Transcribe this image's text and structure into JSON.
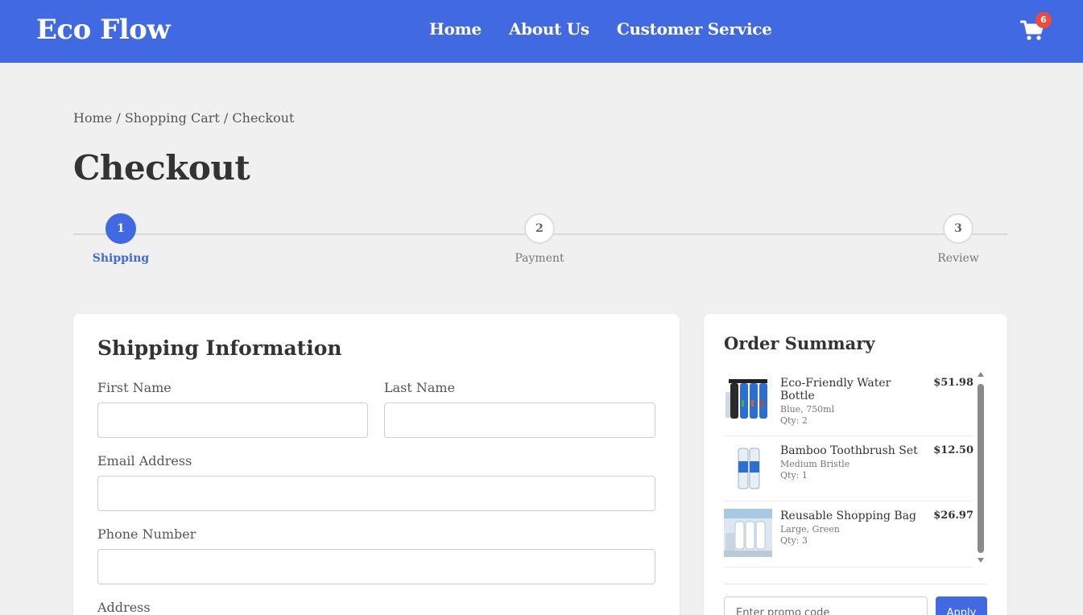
{
  "header": {
    "brand": "Eco Flow",
    "nav": [
      "Home",
      "About Us",
      "Customer Service"
    ],
    "cart_count": "6",
    "cart_icon": "shopping-cart-icon"
  },
  "breadcrumb": {
    "items": [
      "Home",
      "Shopping Cart",
      "Checkout"
    ],
    "separator": "/"
  },
  "page_title": "Checkout",
  "steps": [
    {
      "number": "1",
      "label": "Shipping",
      "active": true
    },
    {
      "number": "2",
      "label": "Payment",
      "active": false
    },
    {
      "number": "3",
      "label": "Review",
      "active": false
    }
  ],
  "shipping": {
    "title": "Shipping Information",
    "first_name_label": "First Name",
    "last_name_label": "Last Name",
    "email_label": "Email Address",
    "phone_label": "Phone Number",
    "address_label": "Address"
  },
  "summary": {
    "title": "Order Summary",
    "items": [
      {
        "name": "Eco-Friendly Water Bottle",
        "variant": "Blue, 750ml",
        "qty": "Qty: 2",
        "price": "$51.98"
      },
      {
        "name": "Bamboo Toothbrush Set",
        "variant": "Medium Bristle",
        "qty": "Qty: 1",
        "price": "$12.50"
      },
      {
        "name": "Reusable Shopping Bag",
        "variant": "Large, Green",
        "qty": "Qty: 3",
        "price": "$26.97"
      }
    ],
    "promo_placeholder": "Enter promo code",
    "apply_label": "Apply"
  },
  "colors": {
    "accent": "#4169e1",
    "badge": "#f04a3a",
    "background": "#f0f0f0"
  }
}
